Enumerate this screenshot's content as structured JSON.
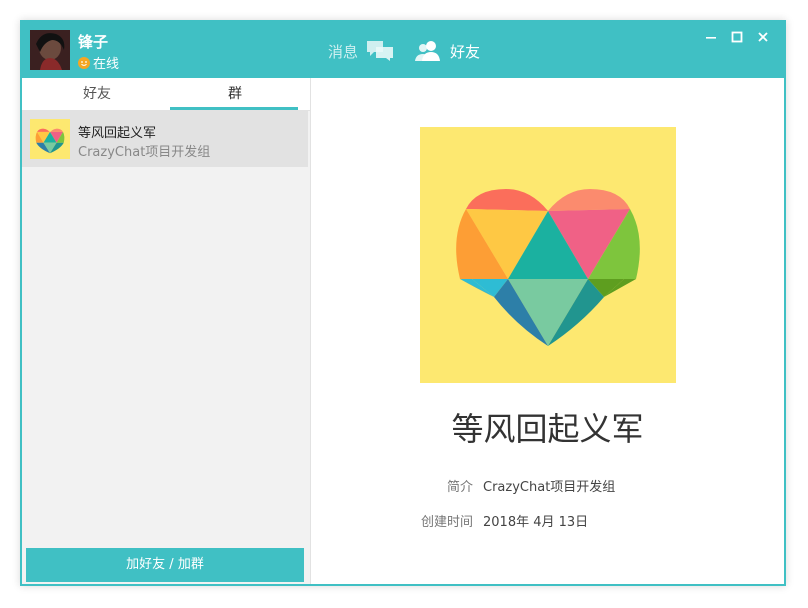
{
  "user": {
    "name": "锋子",
    "status": "在线",
    "status_color": "#f5a623",
    "avatar_icon": "user-avatar-photo"
  },
  "nav": {
    "messages_label": "消息",
    "messages_icon": "chat-bubbles-icon",
    "friends_label": "好友",
    "friends_icon": "users-icon"
  },
  "window_controls": {
    "minimize": "—",
    "maximize": "☐",
    "close": "✕"
  },
  "tabs": [
    {
      "label": "好友",
      "active": false
    },
    {
      "label": "群",
      "active": true
    }
  ],
  "groups": [
    {
      "name": "等风回起义军",
      "desc": "CrazyChat项目开发组",
      "icon": "heart-group-icon"
    }
  ],
  "add_button_label": "加好友 / 加群",
  "detail": {
    "title": "等风回起义军",
    "intro_label": "简介",
    "intro_value": "CrazyChat项目开发组",
    "created_label": "创建时间",
    "created_value": "2018年 4月 13日"
  },
  "colors": {
    "accent": "#40c0c4",
    "image_bg": "#fde870"
  }
}
